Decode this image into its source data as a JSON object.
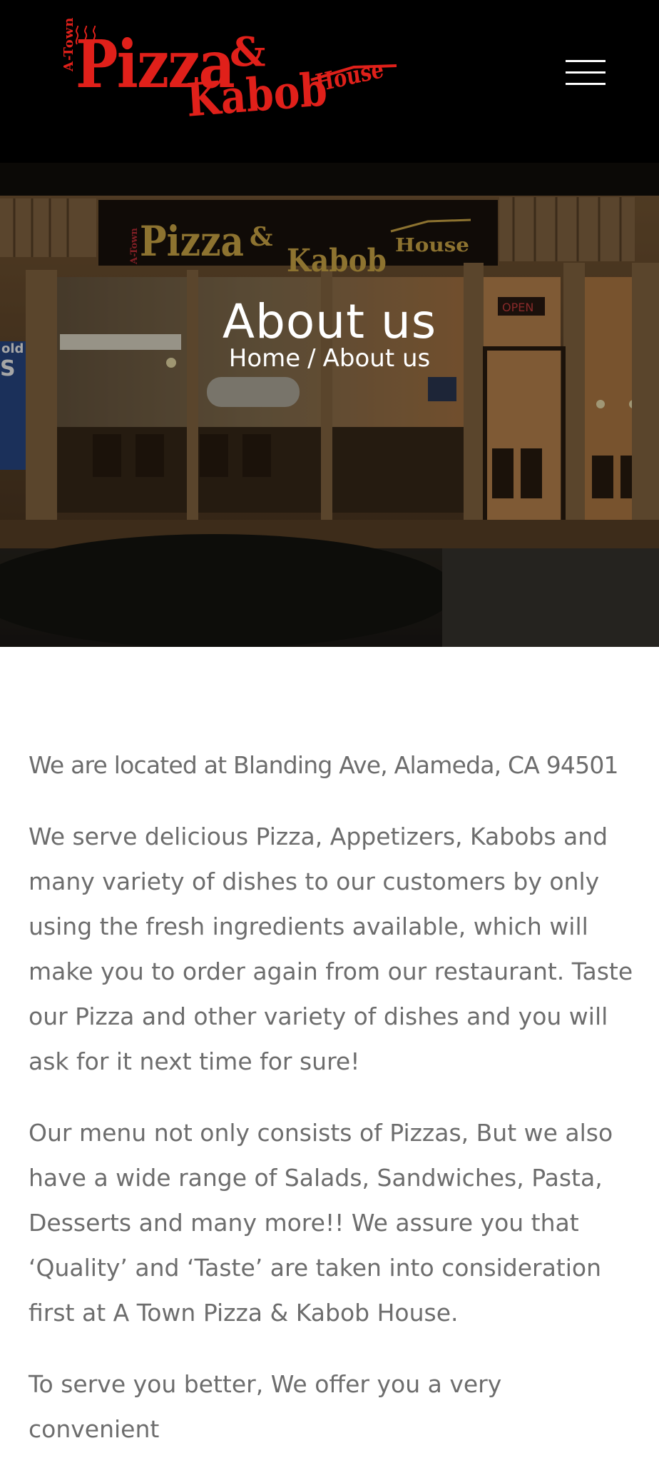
{
  "header": {
    "logo": {
      "line_small": "A-Town",
      "word_pizza": "Pizza",
      "amp": "&",
      "word_kabob": "Kabob",
      "word_house": "House",
      "color": "#e0201a"
    },
    "menu_icon": "hamburger-menu-icon"
  },
  "hero": {
    "title": "About us",
    "breadcrumb": {
      "home": "Home",
      "separator": "/",
      "current": "About us"
    },
    "sign": {
      "line_small": "A-Town",
      "word_pizza": "Pizza",
      "amp": "&",
      "word_kabob": "Kabob",
      "word_house": "House",
      "open_sign": "OPEN",
      "window_partial": "old"
    }
  },
  "content": {
    "paragraphs": [
      "We are located at Blanding Ave, Alameda, CA 94501",
      "We serve delicious Pizza, Appetizers, Kabobs and many variety of dishes to our customers by only using the fresh ingredients available, which will make you to order again from our restaurant. Taste our Pizza and other variety of dishes and you will ask for it next time for sure!",
      "Our menu not only consists of Pizzas, But we also have a wide range of Salads, Sandwiches, Pasta, Desserts and many more!! We assure you that ‘Quality’ and ‘Taste’ are taken into consideration first at A Town Pizza & Kabob House.",
      "To serve you better, We offer you a very convenient"
    ]
  },
  "colors": {
    "header_bg": "#000000",
    "body_text": "#6d6d6d",
    "hero_text": "#ffffff"
  }
}
